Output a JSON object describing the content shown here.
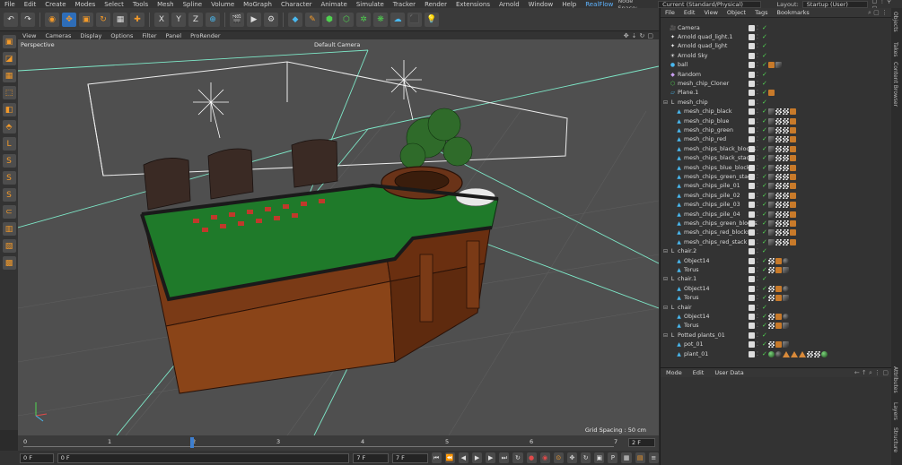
{
  "menubar": {
    "items": [
      "File",
      "Edit",
      "Create",
      "Modes",
      "Select",
      "Tools",
      "Mesh",
      "Spline",
      "Volume",
      "MoGraph",
      "Character",
      "Animate",
      "Simulate",
      "Tracker",
      "Render",
      "Extensions",
      "Arnold",
      "Window",
      "Help",
      "RealFlow"
    ],
    "highlight": "RealFlow",
    "node_space_label": "Node Space:",
    "node_space_value": "Current (Standard/Physical)",
    "layout_label": "Layout:",
    "layout_value": "Startup (User)"
  },
  "toolbar": {
    "icons": [
      "undo-icon",
      "redo-icon",
      "live-select-icon",
      "move-icon",
      "scale-icon",
      "rotate-icon",
      "recent-tools-icon",
      "axis-x-icon",
      "axis-y-icon",
      "axis-z-icon",
      "world-coords-icon",
      "render-view-icon",
      "render-picture-queue-icon",
      "render-settings-icon",
      "cube-icon",
      "pen-icon",
      "subdivision-icon",
      "cloner-icon",
      "deformer-icon",
      "environment-icon",
      "camera-icon",
      "light-icon"
    ],
    "axis_labels": [
      "X",
      "Y",
      "Z"
    ]
  },
  "viewport": {
    "menu": [
      "View",
      "Cameras",
      "Display",
      "Options",
      "Filter",
      "Panel",
      "ProRender"
    ],
    "view_name": "Perspective",
    "camera_name": "Default Camera",
    "grid_spacing": "Grid Spacing : 50 cm"
  },
  "timeline": {
    "ticks": [
      "0",
      "1",
      "2",
      "3",
      "4",
      "5",
      "6",
      "7"
    ],
    "end_frame": "2 F",
    "current": 2
  },
  "transport": {
    "start": "0 F",
    "current": "0 F",
    "end_a": "7 F",
    "end_b": "7 F"
  },
  "object_manager": {
    "menu": [
      "File",
      "Edit",
      "View",
      "Object",
      "Tags",
      "Bookmarks"
    ],
    "rows": [
      {
        "name": "Camera",
        "indent": 0,
        "icon": "camera-icon",
        "tags": []
      },
      {
        "name": "Arnold quad_light.1",
        "indent": 0,
        "icon": "light-icon",
        "tags": []
      },
      {
        "name": "Arnold quad_light",
        "indent": 0,
        "icon": "light-icon",
        "tags": []
      },
      {
        "name": "Arnold Sky",
        "indent": 0,
        "icon": "sky-icon",
        "tags": []
      },
      {
        "name": "ball",
        "indent": 0,
        "icon": "sphere-icon",
        "tags": [
          "org",
          "mat"
        ]
      },
      {
        "name": "Random",
        "indent": 0,
        "icon": "effector-icon",
        "tags": []
      },
      {
        "name": "mesh_chip_Cloner",
        "indent": 0,
        "icon": "cloner-icon",
        "tags": []
      },
      {
        "name": "Plane.1",
        "indent": 0,
        "icon": "plane-icon",
        "tags": [
          "org"
        ]
      },
      {
        "name": "mesh_chip",
        "indent": 0,
        "icon": "null-icon",
        "tags": []
      },
      {
        "name": "mesh_chip_black",
        "indent": 1,
        "icon": "polygon-icon",
        "tags": [
          "mat",
          "chk-t",
          "chk-t",
          "org"
        ]
      },
      {
        "name": "mesh_chip_blue",
        "indent": 1,
        "icon": "polygon-icon",
        "tags": [
          "mat",
          "chk-t",
          "chk-t",
          "org"
        ]
      },
      {
        "name": "mesh_chip_green",
        "indent": 1,
        "icon": "polygon-icon",
        "tags": [
          "mat",
          "chk-t",
          "chk-t",
          "org"
        ]
      },
      {
        "name": "mesh_chip_red",
        "indent": 1,
        "icon": "polygon-icon",
        "tags": [
          "mat",
          "chk-t",
          "chk-t",
          "org"
        ]
      },
      {
        "name": "mesh_chips_black_blocks",
        "indent": 1,
        "icon": "polygon-icon",
        "tags": [
          "mat",
          "chk-t",
          "chk-t",
          "org"
        ]
      },
      {
        "name": "mesh_chips_black_stack",
        "indent": 1,
        "icon": "polygon-icon",
        "tags": [
          "mat",
          "chk-t",
          "chk-t",
          "org"
        ]
      },
      {
        "name": "mesh_chips_blue_blocks",
        "indent": 1,
        "icon": "polygon-icon",
        "tags": [
          "mat",
          "chk-t",
          "chk-t",
          "org"
        ]
      },
      {
        "name": "mesh_chips_green_stack",
        "indent": 1,
        "icon": "polygon-icon",
        "tags": [
          "mat",
          "chk-t",
          "chk-t",
          "org"
        ]
      },
      {
        "name": "mesh_chips_pile_01",
        "indent": 1,
        "icon": "polygon-icon",
        "tags": [
          "mat",
          "chk-t",
          "chk-t",
          "org"
        ]
      },
      {
        "name": "mesh_chips_pile_02",
        "indent": 1,
        "icon": "polygon-icon",
        "tags": [
          "mat",
          "chk-t",
          "chk-t",
          "org"
        ]
      },
      {
        "name": "mesh_chips_pile_03",
        "indent": 1,
        "icon": "polygon-icon",
        "tags": [
          "mat",
          "chk-t",
          "chk-t",
          "org"
        ]
      },
      {
        "name": "mesh_chips_pile_04",
        "indent": 1,
        "icon": "polygon-icon",
        "tags": [
          "mat",
          "chk-t",
          "chk-t",
          "org"
        ]
      },
      {
        "name": "mesh_chips_green_blocks",
        "indent": 1,
        "icon": "polygon-icon",
        "tags": [
          "mat",
          "chk-t",
          "chk-t",
          "org"
        ]
      },
      {
        "name": "mesh_chips_red_blocks",
        "indent": 1,
        "icon": "polygon-icon",
        "tags": [
          "mat",
          "chk-t",
          "chk-t",
          "org"
        ]
      },
      {
        "name": "mesh_chips_red_stack",
        "indent": 1,
        "icon": "polygon-icon",
        "tags": [
          "mat",
          "chk-t",
          "chk-t",
          "org"
        ]
      },
      {
        "name": "chair.2",
        "indent": 0,
        "icon": "null-icon",
        "tags": []
      },
      {
        "name": "Object14",
        "indent": 1,
        "icon": "polygon-icon",
        "tags": [
          "chk-t",
          "org",
          "ball"
        ]
      },
      {
        "name": "Torus",
        "indent": 1,
        "icon": "polygon-icon",
        "tags": [
          "chk-t",
          "org",
          "mat"
        ]
      },
      {
        "name": "chair.1",
        "indent": 0,
        "icon": "null-icon",
        "tags": []
      },
      {
        "name": "Object14",
        "indent": 1,
        "icon": "polygon-icon",
        "tags": [
          "chk-t",
          "org",
          "ball"
        ]
      },
      {
        "name": "Torus",
        "indent": 1,
        "icon": "polygon-icon",
        "tags": [
          "chk-t",
          "org",
          "mat"
        ]
      },
      {
        "name": "chair",
        "indent": 0,
        "icon": "null-icon",
        "tags": []
      },
      {
        "name": "Object14",
        "indent": 1,
        "icon": "polygon-icon",
        "tags": [
          "chk-t",
          "org",
          "ball"
        ]
      },
      {
        "name": "Torus",
        "indent": 1,
        "icon": "polygon-icon",
        "tags": [
          "chk-t",
          "org",
          "mat"
        ]
      },
      {
        "name": "Potted plants_01",
        "indent": 0,
        "icon": "null-icon",
        "tags": []
      },
      {
        "name": "pot_01",
        "indent": 1,
        "icon": "polygon-icon",
        "tags": [
          "chk-t",
          "org",
          "mat"
        ]
      },
      {
        "name": "plant_01",
        "indent": 1,
        "icon": "polygon-icon",
        "tags": [
          "grn",
          "ball",
          "tri",
          "tri",
          "tri",
          "chk-t",
          "chk-t",
          "grn"
        ]
      }
    ]
  },
  "attributes": {
    "menu": [
      "Mode",
      "Edit",
      "User Data"
    ]
  },
  "side_tabs": [
    "Objects",
    "Takes",
    "Content Browser",
    "Attributes",
    "Layers",
    "Structure"
  ],
  "colors": {
    "accent": "#3e7fd0",
    "grid": "#7ee8c8",
    "felt": "#1f7a2a",
    "wood": "#7a3a16"
  }
}
